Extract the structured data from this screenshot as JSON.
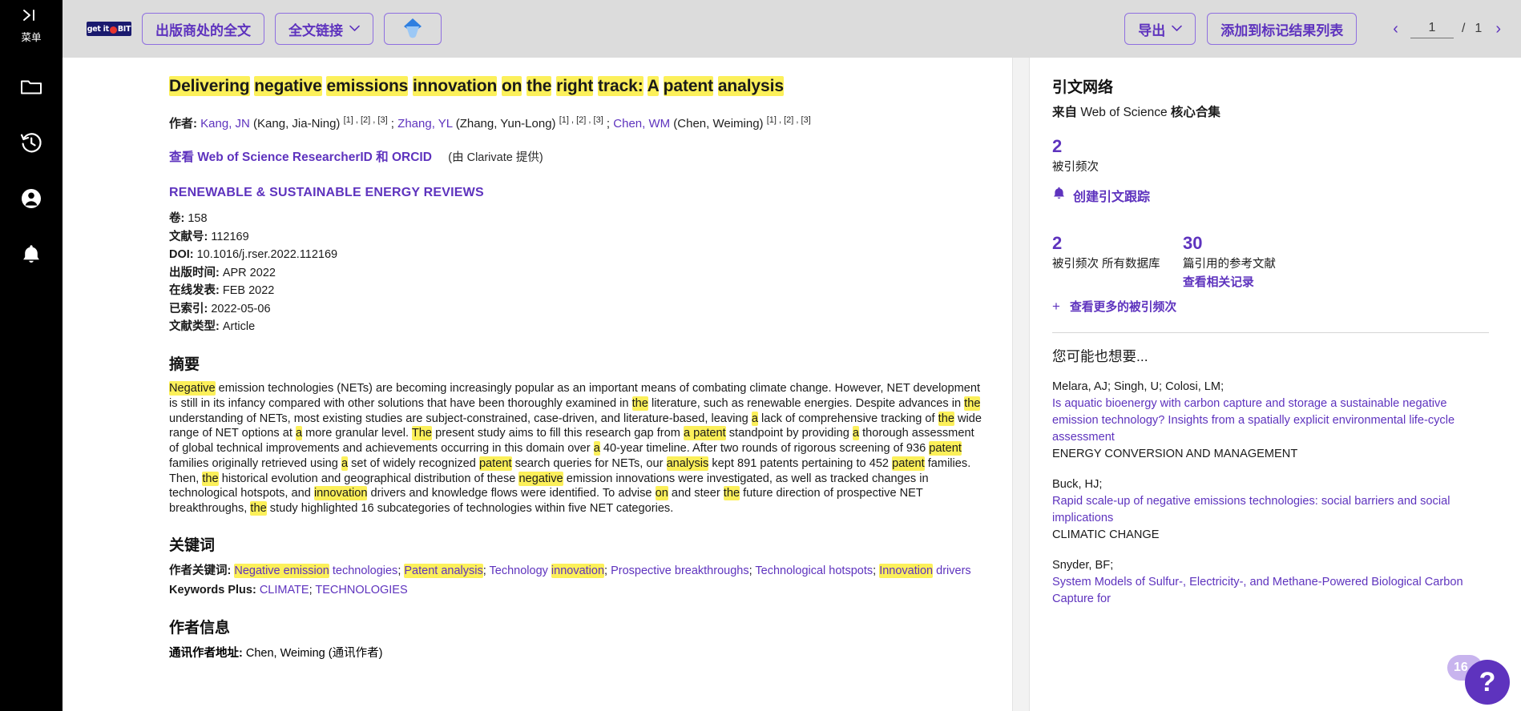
{
  "rail": {
    "menu": {
      "icon": "expand-menu-icon",
      "glyph": "〉|",
      "label": "菜单"
    },
    "items": [
      {
        "name": "folder-icon",
        "title": "文件夹"
      },
      {
        "name": "history-icon",
        "title": "历史"
      },
      {
        "name": "profile-icon",
        "title": "个人资料"
      },
      {
        "name": "bell-icon",
        "title": "通知"
      }
    ]
  },
  "toolbar": {
    "getit_badge": "get it BIT",
    "getit_left": "get it",
    "getit_right": "BIT",
    "publisher_fulltext": "出版商处的全文",
    "fulltext_links": "全文链接",
    "fulltext_caret": "⌄",
    "export": "导出",
    "export_caret": "⌄",
    "add_to_marked": "添加到标记结果列表",
    "diamond_icon": "diamond-icon"
  },
  "pager": {
    "prev": "‹",
    "next": "›",
    "current": "1",
    "separator": "/",
    "total": "1"
  },
  "record": {
    "title_words": [
      "Delivering",
      "negative",
      "emissions",
      "innovation",
      "on",
      "the",
      "right",
      "track:",
      "A",
      "patent",
      "analysis"
    ],
    "title_plain": "Delivering negative emissions innovation on the right track: A patent analysis",
    "authors_label": "作者:",
    "authors": [
      {
        "short": "Kang, JN",
        "full": "(Kang, Jia-Ning)",
        "affil": [
          "[1]",
          "[2]",
          "[3]"
        ]
      },
      {
        "short": "Zhang, YL",
        "full": "(Zhang, Yun-Long)",
        "affil": [
          "[1]",
          "[2]",
          "[3]"
        ]
      },
      {
        "short": "Chen, WM",
        "full": "(Chen, Weiming)",
        "affil": [
          "[1]",
          "[2]",
          "[3]"
        ]
      }
    ],
    "orcid_view": "查看",
    "orcid_text": "Web of Science ResearcherID 和 ORCID",
    "orcid_provider": "(由 Clarivate 提供)",
    "journal": "RENEWABLE & SUSTAINABLE ENERGY REVIEWS",
    "meta": [
      {
        "k": "卷:",
        "v": "158"
      },
      {
        "k": "文献号:",
        "v": "112169"
      },
      {
        "k": "DOI:",
        "v": "10.1016/j.rser.2022.112169"
      },
      {
        "k": "出版时间:",
        "v": "APR 2022"
      },
      {
        "k": "在线发表:",
        "v": "FEB 2022"
      },
      {
        "k": "已索引:",
        "v": "2022-05-06"
      },
      {
        "k": "文献类型:",
        "v": "Article"
      }
    ],
    "abstract_heading": "摘要",
    "abstract_tokens": [
      {
        "t": "Negative",
        "h": true
      },
      {
        "t": " emission technologies (NETs) are becoming increasingly popular as an important means of combating climate change. However, NET development is still in its infancy compared with other solutions that have been thoroughly examined in ",
        "h": false
      },
      {
        "t": "the",
        "h": true
      },
      {
        "t": " literature, such as renewable energies. Despite advances in ",
        "h": false
      },
      {
        "t": "the",
        "h": true
      },
      {
        "t": " understanding of NETs, most existing studies are subject-constrained, case-driven, and literature-based, leaving ",
        "h": false
      },
      {
        "t": "a",
        "h": true
      },
      {
        "t": " lack of comprehensive tracking of ",
        "h": false
      },
      {
        "t": "the",
        "h": true
      },
      {
        "t": " wide range of NET options at ",
        "h": false
      },
      {
        "t": "a",
        "h": true
      },
      {
        "t": " more granular level. ",
        "h": false
      },
      {
        "t": "The",
        "h": true
      },
      {
        "t": " present study aims to fill this research gap from ",
        "h": false
      },
      {
        "t": "a patent",
        "h": true
      },
      {
        "t": " standpoint by providing ",
        "h": false
      },
      {
        "t": "a",
        "h": true
      },
      {
        "t": " thorough assessment of global technical improvements and achievements occurring in this domain over ",
        "h": false
      },
      {
        "t": "a",
        "h": true
      },
      {
        "t": " 40-year timeline. After two rounds of rigorous screening of 936 ",
        "h": false
      },
      {
        "t": "patent",
        "h": true
      },
      {
        "t": " families originally retrieved using ",
        "h": false
      },
      {
        "t": "a",
        "h": true
      },
      {
        "t": " set of widely recognized ",
        "h": false
      },
      {
        "t": "patent",
        "h": true
      },
      {
        "t": " search queries for NETs, our ",
        "h": false
      },
      {
        "t": "analysis",
        "h": true
      },
      {
        "t": " kept 891 patents pertaining to 452 ",
        "h": false
      },
      {
        "t": "patent",
        "h": true
      },
      {
        "t": " families. Then, ",
        "h": false
      },
      {
        "t": "the",
        "h": true
      },
      {
        "t": " historical evolution and geographical distribution of these ",
        "h": false
      },
      {
        "t": "negative",
        "h": true
      },
      {
        "t": " emission innovations were investigated, as well as tracked changes in technological hotspots, and ",
        "h": false
      },
      {
        "t": "innovation",
        "h": true
      },
      {
        "t": " drivers and knowledge flows were identified. To advise ",
        "h": false
      },
      {
        "t": "on",
        "h": true
      },
      {
        "t": " and steer ",
        "h": false
      },
      {
        "t": "the",
        "h": true
      },
      {
        "t": " future direction of prospective NET breakthroughs, ",
        "h": false
      },
      {
        "t": "the",
        "h": true
      },
      {
        "t": " study highlighted 16 subcategories of technologies within five NET categories.",
        "h": false
      }
    ],
    "keywords_heading": "关键词",
    "author_kw_label": "作者关键词:",
    "author_keywords": [
      [
        {
          "t": "Negative emission",
          "h": true
        },
        {
          "t": " technologies",
          "h": false
        }
      ],
      [
        {
          "t": "Patent analysis",
          "h": true
        }
      ],
      [
        {
          "t": "Technology ",
          "h": false
        },
        {
          "t": "innovation",
          "h": true
        }
      ],
      [
        {
          "t": "Prospective breakthroughs",
          "h": false
        }
      ],
      [
        {
          "t": "Technological hotspots",
          "h": false
        }
      ],
      [
        {
          "t": "Innovation",
          "h": true
        },
        {
          "t": " drivers",
          "h": false
        }
      ]
    ],
    "keywords_plus_label": "Keywords Plus:",
    "keywords_plus": [
      "CLIMATE",
      "TECHNOLOGIES"
    ],
    "author_info_heading": "作者信息",
    "corresponding_label": "通讯作者地址:",
    "corresponding_value": "Chen, Weiming (通讯作者)"
  },
  "side": {
    "heading": "引文网络",
    "source_prefix": "来自",
    "source_name": " Web of Science ",
    "source_suffix": "核心合集",
    "times_cited_value": "2",
    "times_cited_label": "被引频次",
    "create_alert": "创建引文跟踪",
    "alert_icon": "bell-icon",
    "metric_all_db_value": "2",
    "metric_all_db_label": "被引频次 所有数据库",
    "metric_refs_value": "30",
    "metric_refs_label": "篇引用的参考文献",
    "view_related": "查看相关记录",
    "more_cited_plus": "+",
    "more_cited": "查看更多的被引频次",
    "rec_heading": "您可能也想要...",
    "recommendations": [
      {
        "authors": "Melara, AJ; Singh, U; Colosi, LM;",
        "title": "Is aquatic bioenergy with carbon capture and storage a sustainable negative emission technology? Insights from a spatially explicit environmental life-cycle assessment",
        "source": "ENERGY CONVERSION AND MANAGEMENT"
      },
      {
        "authors": "Buck, HJ;",
        "title": "Rapid scale-up of negative emissions technologies: social barriers and social implications",
        "source": "CLIMATIC CHANGE"
      },
      {
        "authors": "Snyder, BF;",
        "title": "System Models of Sulfur-, Electricity-, and Methane-Powered Biological Carbon Capture for",
        "source": ""
      }
    ]
  },
  "help": {
    "badge": "16",
    "mark": "?"
  },
  "colors": {
    "accent": "#5e33be",
    "highlight": "#fcf05a",
    "toolbar_bg": "#dcdcdc",
    "rail_bg": "#000000"
  }
}
